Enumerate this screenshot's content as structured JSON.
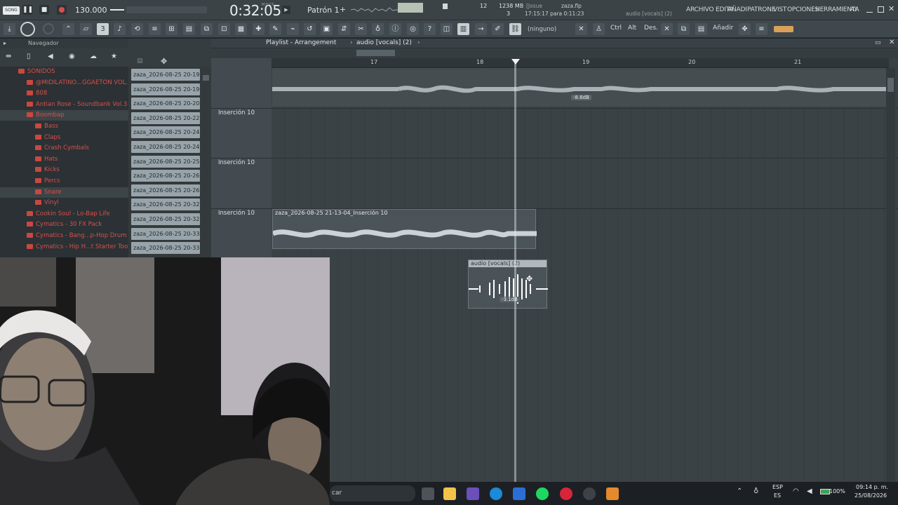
{
  "topbar": {
    "song_label": "SONG",
    "tempo": "130.000",
    "time": "0:32:05",
    "time_unit": "M:S:CS",
    "pattern": "Patrón 1",
    "cpu_num": "12",
    "memory": "1238 MB",
    "poly": "3",
    "hint_user": "[Josue",
    "hint_file": "zaza.flp",
    "hint_time": "17:15:17 para 0:11:23",
    "hint_focus": "audio [vocals] (2)",
    "menus": [
      "ARCHIVO",
      "EDITA",
      "AÑADI",
      "PATRONE",
      "VIST",
      "OPCIONES",
      "HERRAMIENTA",
      "AY"
    ]
  },
  "toolbar": {
    "preset_label": "(ninguno)",
    "ctrl_label": "Ctrl",
    "alt_label": "Alt",
    "des_label": "Des.",
    "add_label": "Añadir"
  },
  "browser": {
    "title": "Navegador",
    "items": [
      {
        "label": "SONIDOS",
        "indent": 0
      },
      {
        "label": "@MIDILATINO...GGAETON VOL. 1",
        "indent": 1
      },
      {
        "label": "808",
        "indent": 1
      },
      {
        "label": "Antian Rose - Soundbank Vol.3",
        "indent": 1
      },
      {
        "label": "Boombap",
        "indent": 1
      },
      {
        "label": "Bass",
        "indent": 2
      },
      {
        "label": "Claps",
        "indent": 2
      },
      {
        "label": "Crash Cymbals",
        "indent": 2
      },
      {
        "label": "Hats",
        "indent": 2
      },
      {
        "label": "Kicks",
        "indent": 2
      },
      {
        "label": "Percs",
        "indent": 2
      },
      {
        "label": "Snare",
        "indent": 2
      },
      {
        "label": "Vinyl",
        "indent": 2
      },
      {
        "label": "Cookin Soul - Lo-Bap Life",
        "indent": 1
      },
      {
        "label": "Cymatics - 30 FX Pack",
        "indent": 1
      },
      {
        "label": "Cymatics - Bang...p-Hop Drum Kit",
        "indent": 1
      },
      {
        "label": "Cymatics - Hip H...t Starter Toolkit",
        "indent": 1
      }
    ]
  },
  "clip_list": [
    "zaza_2026-08-25 20-19...",
    "zaza_2026-08-25 20-19...",
    "zaza_2026-08-25 20-20...",
    "zaza_2026-08-25 20-22...",
    "zaza_2026-08-25 20-24...",
    "zaza_2026-08-25 20-24...",
    "zaza_2026-08-25 20-25...",
    "zaza_2026-08-25 20-26...",
    "zaza_2026-08-25 20-26...",
    "zaza_2026-08-25 20-32...",
    "zaza_2026-08-25 20-32...",
    "zaza_2026-08-25 20-33...",
    "zaza_2026-08-25 20-33..."
  ],
  "playlist": {
    "title": "Playlist - Arrangement",
    "breadcrumb_sep": "›",
    "focus": "audio [vocals] (2)",
    "ruler": [
      "17",
      "18",
      "19",
      "20",
      "21"
    ],
    "tracks": [
      "Inserción 10",
      "Inserción 10",
      "Inserción 10"
    ],
    "clip_a_db": "-8.6dB",
    "clip_b_title": "zaza_2026-08-25 21-13-04_Inserción 10",
    "clip_c_title": "audio [vocals] (2)",
    "clip_c_db": "-3.1dB"
  },
  "taskbar": {
    "search_text": "car",
    "lang": "ESP",
    "lang_sub": "ES",
    "battery": "100%",
    "clock_time": "09:14 p. m.",
    "clock_date": "25/08/2026"
  }
}
